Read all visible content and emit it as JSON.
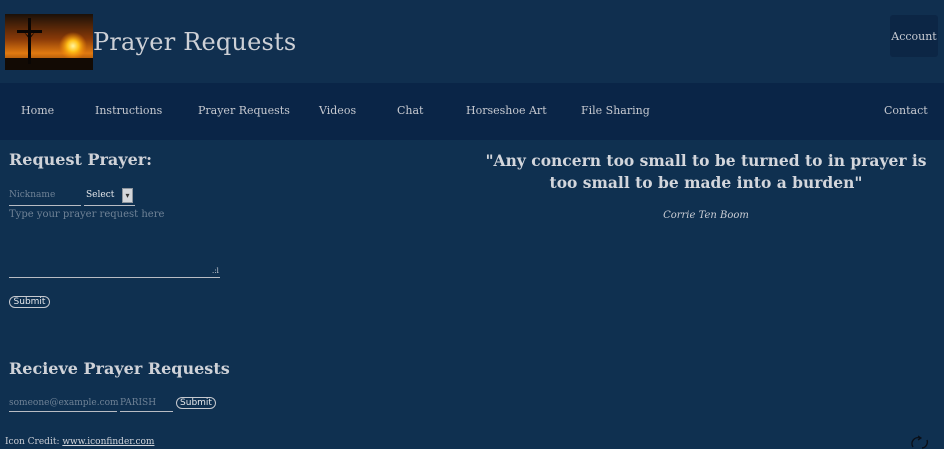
{
  "header": {
    "site_title": "Prayer Requests",
    "account_label": "Account"
  },
  "nav": {
    "items": [
      {
        "label": "Home"
      },
      {
        "label": "Instructions"
      },
      {
        "label": "Prayer Requests"
      },
      {
        "label": "Videos"
      },
      {
        "label": "Chat"
      },
      {
        "label": "Horseshoe Art"
      },
      {
        "label": "File Sharing"
      },
      {
        "label": "Contact"
      }
    ]
  },
  "request_form": {
    "heading": "Request Prayer:",
    "nickname_placeholder": "Nickname",
    "select_value": "Select",
    "request_placeholder": "Type your prayer request here",
    "submit_label": "Submit"
  },
  "quote": {
    "text": "\"Any concern too small to be turned to in prayer is too small to be made into a burden\"",
    "author": "Corrie Ten Boom"
  },
  "receive_form": {
    "heading": "Recieve Prayer Requests",
    "email_placeholder": "someone@example.com",
    "parish_placeholder": "PARISH",
    "submit_label": "Submit"
  },
  "footer": {
    "credit_prefix": "Icon Credit: ",
    "credit_link": "www.iconfinder.com"
  },
  "colors": {
    "page_bg": "#0f3050",
    "nav_bg": "#0a2547",
    "account_bg": "#0c2645",
    "text": "#c9ccd3"
  },
  "icons": {
    "logo": "crucifix-sunset-logo",
    "corner": "refresh-icon"
  }
}
